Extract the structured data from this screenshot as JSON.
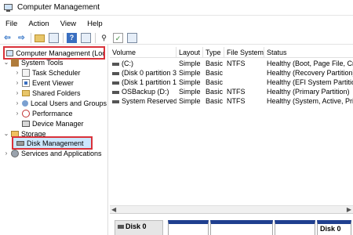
{
  "window": {
    "title": "Computer Management"
  },
  "menu": [
    "File",
    "Action",
    "View",
    "Help"
  ],
  "toolbar": {
    "icons": [
      "back-arrow-icon",
      "forward-arrow-icon",
      "up-folder-icon",
      "show-tree-icon",
      "help-icon",
      "properties-icon",
      "connect-icon",
      "check-icon",
      "view-icon"
    ]
  },
  "tree": {
    "root": "Computer Management (Local)",
    "system_tools": "System Tools",
    "task_scheduler": "Task Scheduler",
    "event_viewer": "Event Viewer",
    "shared_folders": "Shared Folders",
    "local_users": "Local Users and Groups",
    "performance": "Performance",
    "device_manager": "Device Manager",
    "storage": "Storage",
    "disk_management": "Disk Management",
    "services": "Services and Applications"
  },
  "list": {
    "columns": [
      "Volume",
      "Layout",
      "Type",
      "File System",
      "Status"
    ],
    "rows": [
      [
        "(C:)",
        "Simple",
        "Basic",
        "NTFS",
        "Healthy (Boot, Page File, Crash Dump, Primary Partition)"
      ],
      [
        "(Disk 0 partition 3)",
        "Simple",
        "Basic",
        "",
        "Healthy (Recovery Partition)"
      ],
      [
        "(Disk 1 partition 1)",
        "Simple",
        "Basic",
        "",
        "Healthy (EFI System Partition)"
      ],
      [
        "OSBackup (D:)",
        "Simple",
        "Basic",
        "NTFS",
        "Healthy (Primary Partition)"
      ],
      [
        "System Reserved",
        "Simple",
        "Basic",
        "NTFS",
        "Healthy (System, Active, Primary Partition)"
      ]
    ]
  },
  "graphical": {
    "disk0_label": "Disk 0",
    "disk0_right_label": "Disk 0"
  },
  "colors": {
    "highlight": "#d9323a",
    "selection": "#cce8ff",
    "partition_bar": "#1f3f8f"
  }
}
